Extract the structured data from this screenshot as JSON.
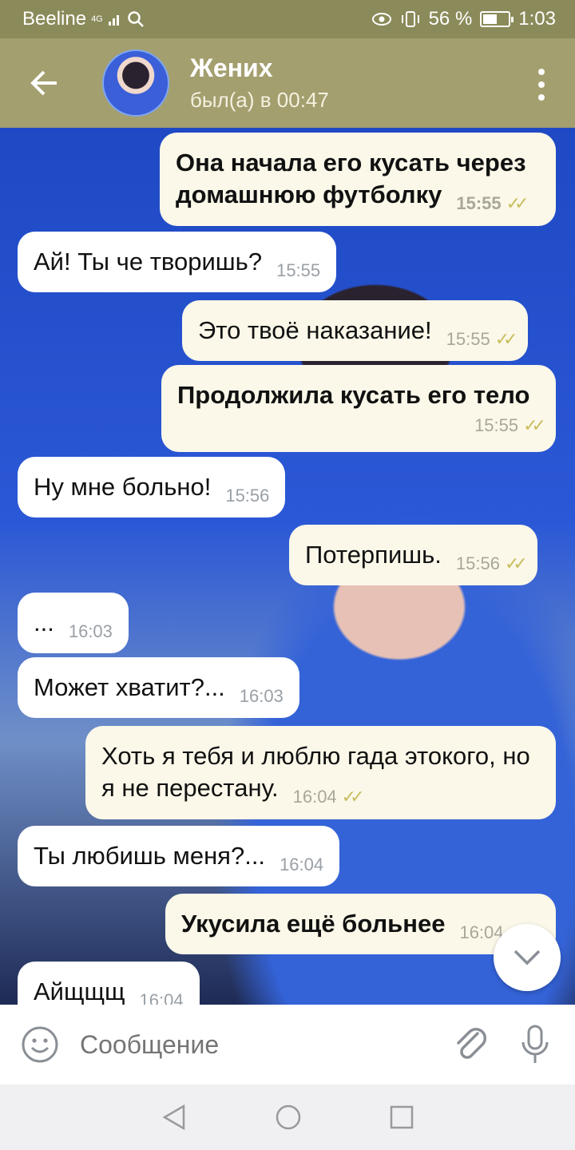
{
  "status": {
    "carrier": "Beeline",
    "network": "4G",
    "battery": "56 %",
    "battery_level": 0.56,
    "time": "1:03"
  },
  "header": {
    "contact_name": "Жених",
    "last_seen": "был(а) в 00:47"
  },
  "messages": [
    {
      "dir": "out",
      "text": "Она начала его кусать через домашнюю футболку",
      "time": "15:55",
      "read": true,
      "bold": true
    },
    {
      "dir": "in",
      "text": "Ай! Ты че творишь?",
      "time": "15:55"
    },
    {
      "dir": "out",
      "text": "Это твоё наказание!",
      "time": "15:55",
      "read": true
    },
    {
      "dir": "out",
      "text": "Продолжила кусать его тело",
      "time": "15:55",
      "read": true,
      "bold": true
    },
    {
      "dir": "in",
      "text": "Ну мне больно!",
      "time": "15:56"
    },
    {
      "dir": "out",
      "text": "Потерпишь.",
      "time": "15:56",
      "read": true
    },
    {
      "dir": "in",
      "text": "...",
      "time": "16:03"
    },
    {
      "dir": "in",
      "text": "Может хватит?...",
      "time": "16:03"
    },
    {
      "dir": "out",
      "text": "Хоть я тебя и люблю гада этокого, но я не перестану.",
      "time": "16:04",
      "read": true
    },
    {
      "dir": "in",
      "text": "Ты любишь меня?...",
      "time": "16:04"
    },
    {
      "dir": "out",
      "text": "Укусила ещё больнее",
      "time": "16:04",
      "read": true,
      "bold": true
    },
    {
      "dir": "in",
      "text": "Айщщщ",
      "time": "16:04"
    }
  ],
  "input": {
    "placeholder": "Сообщение"
  },
  "icons": [
    "back-arrow-icon",
    "more-vertical-icon",
    "emoji-icon",
    "paperclip-icon",
    "microphone-icon",
    "chevron-down-icon",
    "nav-back-icon",
    "nav-home-icon",
    "nav-recents-icon"
  ]
}
